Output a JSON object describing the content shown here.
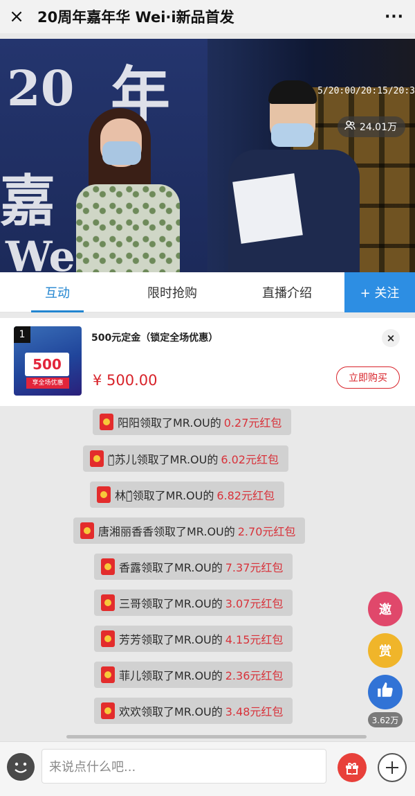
{
  "header": {
    "close_icon": "×",
    "title": "20周年嘉年华 Wei·i新品首发",
    "more_icon": "···"
  },
  "video": {
    "viewer_icon": "people-icon",
    "viewers": "24.01万",
    "schedule_text": "5/20:00/20:15/20:3"
  },
  "tabs": [
    {
      "label": "互动",
      "active": true
    },
    {
      "label": "限时抢购",
      "active": false
    },
    {
      "label": "直播介绍",
      "active": false
    }
  ],
  "follow_label": "+ 关注",
  "product": {
    "rank": "1",
    "ticket_value": "500",
    "ticket_note": "享全场优惠",
    "title": "500元定金（锁定全场优惠）",
    "price": "¥ 500.00",
    "buy_label": "立即购买",
    "close_icon": "×"
  },
  "messages": [
    {
      "text": "阳阳领取了MR.OU的",
      "amount": "0.27元红包"
    },
    {
      "text": "婉᷈苏儿领取了MR.OU的",
      "amount": "6.02元红包"
    },
    {
      "text": "林头᷈领取了MR.OU的",
      "amount": "6.82元红包"
    },
    {
      "text": "唐湘丽香香领取了MR.OU的",
      "amount": "2.70元红包"
    },
    {
      "text": "香露领取了MR.OU的",
      "amount": "7.37元红包"
    },
    {
      "text": "三哥领取了MR.OU的",
      "amount": "3.07元红包"
    },
    {
      "text": "芳芳领取了MR.OU的",
      "amount": "4.15元红包"
    },
    {
      "text": "菲儿领取了MR.OU的",
      "amount": "2.36元红包"
    },
    {
      "text": "欢欢领取了MR.OU的",
      "amount": "3.48元红包"
    }
  ],
  "floating": {
    "invite_label": "邀",
    "reward_label": "赏",
    "like_icon": "thumbs-up-icon",
    "like_count": "3.62万"
  },
  "bottom": {
    "input_placeholder": "来说点什么吧...",
    "emoji_icon": "emoji-icon",
    "gift_icon": "gift-icon",
    "plus_icon": "plus-icon"
  },
  "colors": {
    "accent_blue": "#2d8ee3",
    "price_red": "#d8232a",
    "message_bg": "#d1d1d1"
  }
}
